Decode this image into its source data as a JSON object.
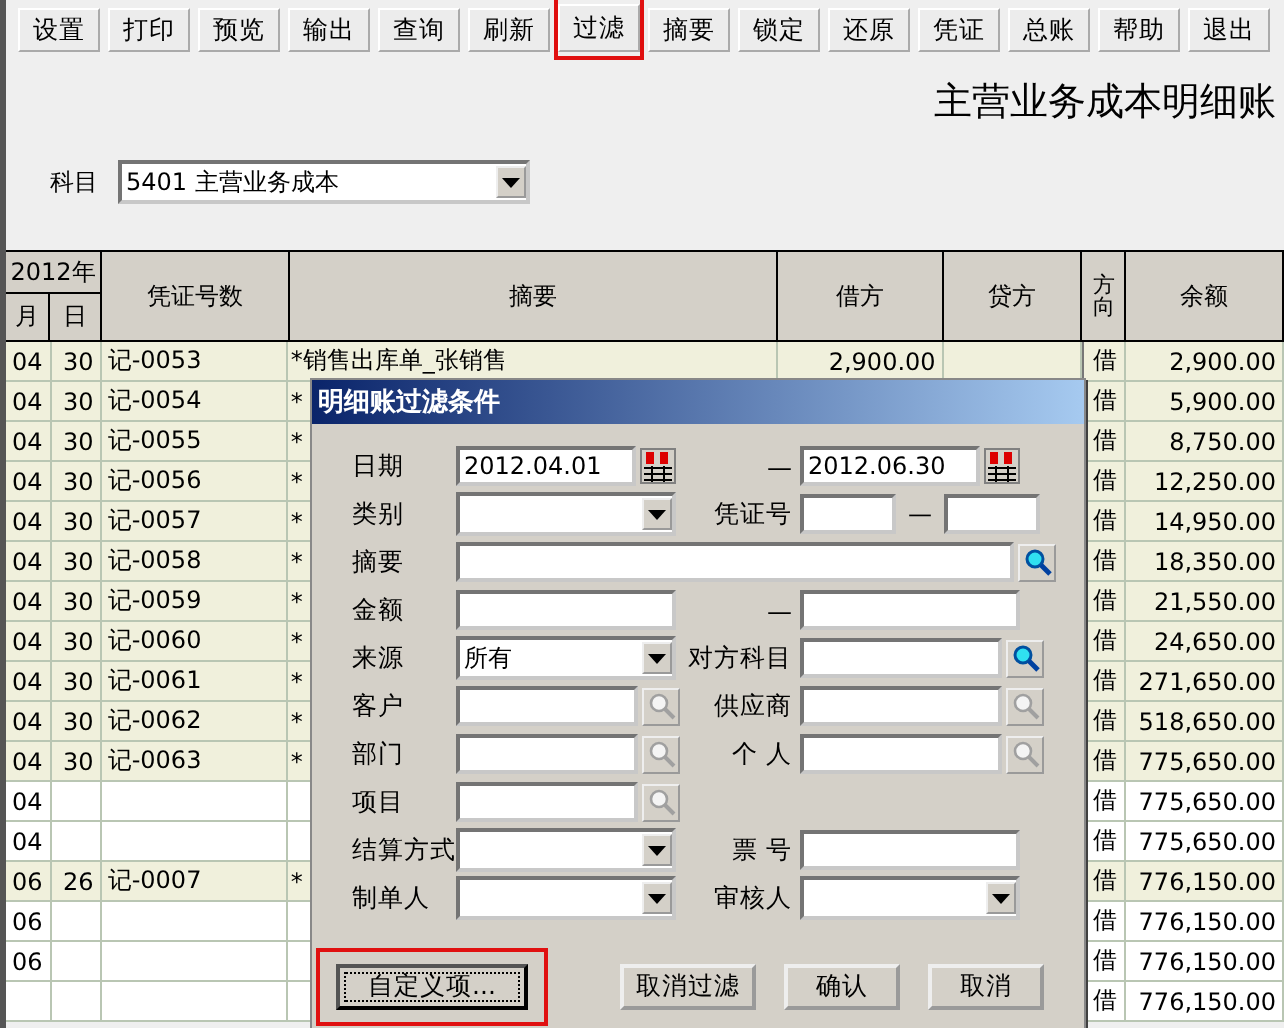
{
  "toolbar": [
    {
      "label": "设置",
      "highlighted": false
    },
    {
      "label": "打印",
      "highlighted": false
    },
    {
      "label": "预览",
      "highlighted": false
    },
    {
      "label": "输出",
      "highlighted": false
    },
    {
      "label": "查询",
      "highlighted": false
    },
    {
      "label": "刷新",
      "highlighted": false
    },
    {
      "label": "过滤",
      "highlighted": true
    },
    {
      "label": "摘要",
      "highlighted": false
    },
    {
      "label": "锁定",
      "highlighted": false
    },
    {
      "label": "还原",
      "highlighted": false
    },
    {
      "label": "凭证",
      "highlighted": false
    },
    {
      "label": "总账",
      "highlighted": false
    },
    {
      "label": "帮助",
      "highlighted": false
    },
    {
      "label": "退出",
      "highlighted": false
    }
  ],
  "report_title": "主营业务成本明细账",
  "subject": {
    "label": "科目",
    "value": "5401  主营业务成本"
  },
  "table": {
    "year_header": "2012年",
    "columns": [
      "月",
      "日",
      "凭证号数",
      "摘要",
      "借方",
      "贷方",
      "方向",
      "余额"
    ],
    "rows": [
      {
        "kind": "entry",
        "month": "04",
        "day": "30",
        "voucher": "记-0053",
        "summary": "*销售出库单_张销售",
        "debit": "2,900.00",
        "direction": "借",
        "balance": "2,900.00"
      },
      {
        "kind": "entry",
        "month": "04",
        "day": "30",
        "voucher": "记-0054",
        "summary": "*",
        "direction": "借",
        "balance": "5,900.00"
      },
      {
        "kind": "entry",
        "month": "04",
        "day": "30",
        "voucher": "记-0055",
        "summary": "*",
        "direction": "借",
        "balance": "8,750.00"
      },
      {
        "kind": "entry",
        "month": "04",
        "day": "30",
        "voucher": "记-0056",
        "summary": "*",
        "direction": "借",
        "balance": "12,250.00"
      },
      {
        "kind": "entry",
        "month": "04",
        "day": "30",
        "voucher": "记-0057",
        "summary": "*",
        "direction": "借",
        "balance": "14,950.00"
      },
      {
        "kind": "entry",
        "month": "04",
        "day": "30",
        "voucher": "记-0058",
        "summary": "*",
        "direction": "借",
        "balance": "18,350.00"
      },
      {
        "kind": "entry",
        "month": "04",
        "day": "30",
        "voucher": "记-0059",
        "summary": "*",
        "direction": "借",
        "balance": "21,550.00"
      },
      {
        "kind": "entry",
        "month": "04",
        "day": "30",
        "voucher": "记-0060",
        "summary": "*",
        "direction": "借",
        "balance": "24,650.00"
      },
      {
        "kind": "entry",
        "month": "04",
        "day": "30",
        "voucher": "记-0061",
        "summary": "*",
        "direction": "借",
        "balance": "271,650.00"
      },
      {
        "kind": "entry",
        "month": "04",
        "day": "30",
        "voucher": "记-0062",
        "summary": "*",
        "direction": "借",
        "balance": "518,650.00"
      },
      {
        "kind": "entry",
        "month": "04",
        "day": "30",
        "voucher": "记-0063",
        "summary": "*",
        "direction": "借",
        "balance": "775,650.00"
      },
      {
        "kind": "total",
        "month": "04",
        "direction": "借",
        "balance": "775,650.00"
      },
      {
        "kind": "total",
        "month": "04",
        "direction": "借",
        "balance": "775,650.00"
      },
      {
        "kind": "entry",
        "month": "06",
        "day": "26",
        "voucher": "记-0007",
        "summary": "*",
        "direction": "借",
        "balance": "776,150.00"
      },
      {
        "kind": "total",
        "month": "06",
        "direction": "借",
        "balance": "776,150.00"
      },
      {
        "kind": "total",
        "month": "06",
        "direction": "借",
        "balance": "776,150.00"
      },
      {
        "kind": "total",
        "direction": "借",
        "balance": "776,150.00"
      }
    ]
  },
  "filter_dialog": {
    "title": "明细账过滤条件",
    "rows": [
      [
        {
          "label": "日期",
          "kind": "date",
          "value": "2012.04.01"
        },
        {
          "label": "—",
          "kind": "date",
          "value": "2012.06.30"
        }
      ],
      [
        {
          "label": "类别",
          "kind": "combo"
        },
        {
          "label": "凭证号",
          "kind": "range",
          "separator": "—"
        }
      ],
      [
        {
          "label": "摘要",
          "kind": "wide_search"
        }
      ],
      [
        {
          "label": "金额",
          "kind": "text"
        },
        {
          "label": "—",
          "kind": "text"
        }
      ],
      [
        {
          "label": "来源",
          "kind": "combo",
          "value": "所有"
        },
        {
          "label": "对方科目",
          "kind": "search"
        }
      ],
      [
        {
          "label": "客户",
          "kind": "lookup"
        },
        {
          "label": "供应商",
          "kind": "lookup"
        }
      ],
      [
        {
          "label": "部门",
          "kind": "lookup"
        },
        {
          "label": "个 人",
          "kind": "lookup"
        }
      ],
      [
        {
          "label": "项目",
          "kind": "lookup"
        }
      ],
      [
        {
          "label": "结算方式",
          "kind": "combo"
        },
        {
          "label": "票 号",
          "kind": "text"
        }
      ],
      [
        {
          "label": "制单人",
          "kind": "combo"
        },
        {
          "label": "审核人",
          "kind": "combo"
        }
      ]
    ],
    "buttons": [
      {
        "label": "自定义项...",
        "highlighted": true,
        "focused": true
      },
      {
        "label": "取消过滤",
        "highlighted": false,
        "focused": false
      },
      {
        "label": "确认",
        "highlighted": false,
        "focused": false
      },
      {
        "label": "取消",
        "highlighted": false,
        "focused": false
      }
    ]
  }
}
